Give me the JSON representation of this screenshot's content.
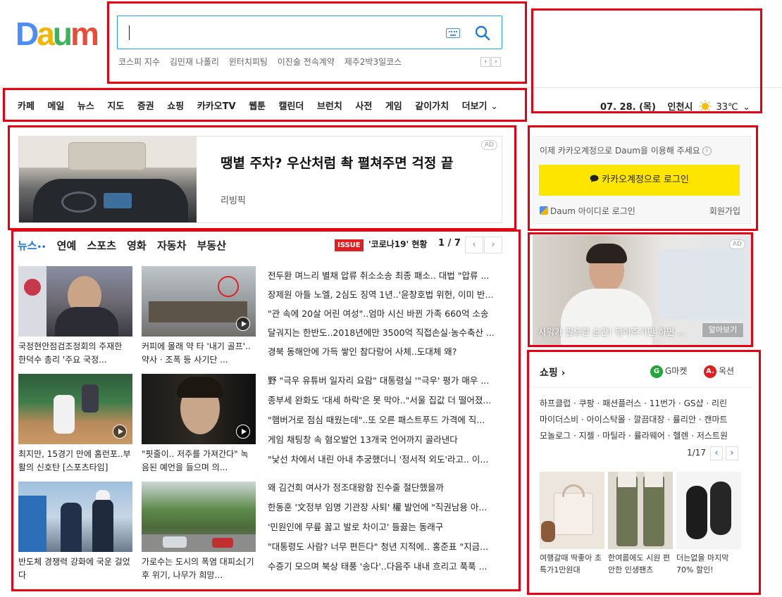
{
  "logo": {
    "text": "Daum",
    "letters": [
      "D",
      "a",
      "u",
      "m"
    ],
    "colors": [
      "#4e8df5",
      "#f5b400",
      "#3cb25c",
      "#ea4c3a"
    ]
  },
  "search": {
    "placeholder": "",
    "trending": [
      "코스피 지수",
      "김민재 나폴리",
      "윈터치피팅",
      "이진술 전속계약",
      "제주2박3일코스"
    ],
    "prev": "‹",
    "next": "›"
  },
  "nav": {
    "items": [
      "카페",
      "메일",
      "뉴스",
      "지도",
      "증권",
      "쇼핑",
      "카카오TV",
      "웹툰",
      "캘린더",
      "브런치",
      "사전",
      "게임",
      "같이가치",
      "더보기"
    ]
  },
  "weather": {
    "date": "07. 28. (목)",
    "city": "인천시",
    "temp": "33℃"
  },
  "ad_banner": {
    "tag": "AD",
    "headline": "땡볕 주차? 우산처럼 촥 펼쳐주면 걱정 끝",
    "brand": "리빙픽"
  },
  "news": {
    "tabs": [
      "뉴스",
      "연예",
      "스포츠",
      "영화",
      "자동차",
      "부동산"
    ],
    "issue_badge": "ISSUE",
    "issue_text": "'코로나19' 현황",
    "page": "1 / 7",
    "cards": [
      {
        "caption": "국정현안점검조정회의 주재한 한덕수 총리 '주요 국정..."
      },
      {
        "caption": "커피에 몰래 약 타 '내기 골프'..약사 · 조폭 등 사기단 ..."
      },
      {
        "caption": "최지만, 15경기 만에 홈런포..부활의 신호탄 [스포츠타임]"
      },
      {
        "caption": "\"핏줄이.. 저주를 가져간다\" 녹음된 예언을 들으며 의..."
      },
      {
        "caption": "반도체 경쟁력 강화에 국운 걸었다"
      },
      {
        "caption": "가로수는 도시의 폭염 대피소[기후 위기, 나무가 희망..."
      }
    ],
    "headlines": [
      "전두환 며느리 별채 압류 취소소송 최종 패소.. 대법 \"압류 ...",
      "장제원 아들 노엘, 2심도 징역 1년..'윤창호법 위헌, 이미 반...",
      "\"관 속에 20살 어린 여성\"..엄마 시신 바뀐 가족 660억 소송",
      "달궈지는 한반도..2018년에만 3500억 직접손실·농수축산 ...",
      "경북 동해안에 가득 쌓인 참다랑어 사체..도대체 왜?",
      "野 \"극우 유튜버 일자리 요람\" 대통령실 '\"극우' 평가 매우 ...",
      "종부세 완화도 '대세 하락'은 못 막아..\"서울 집값 더 떨어졌...",
      "\"햄버거로 점심 때웠는데\"..또 오른 패스트푸드 가격에 직...",
      "게임 채팅창 속 혐오발언 13개국 언어까지 골라낸다",
      "\"낯선 차에서 내린 아내 추궁했더니 '정서적 외도'라고.. 이...",
      "왜 김건희 여사가 정조대왕함 진수줄 절단했을까",
      "한동훈 '文정부 임명 기관장 사퇴' 權 발언에 \"직권남용 아...",
      "'민원인에 무릎 꿇고 발로 차이고' 들끓는 동래구",
      "\"대통령도 사람? 너무 편든다\" 청년 지적에.. 홍준표 \"지금...",
      "수증기 모으며 북상 태풍 '송다'..다음주 내내 흐리고 푹푹 ..."
    ]
  },
  "login": {
    "message": "이제 카카오계정으로 Daum을 이용해 주세요",
    "info": "i",
    "kakao_button": "카카오계정으로 로그인",
    "daum_login": "Daum 아이디로 로그인",
    "signup": "회원가입"
  },
  "side_ad": {
    "tag": "AD",
    "text": "사워가 필요한 순간! 닦아주기만 하면 ...",
    "button": "알아보기"
  },
  "shopping": {
    "title": "쇼핑 ›",
    "gmarket_logo": "G",
    "gmarket": "G마켓",
    "auction_logo": "A.",
    "auction": "옥션",
    "list": [
      "하프클럽 · 쿠팡 · 패션플러스 · 11번가 · GS샵 · 리린",
      "마이더스비 · 아이스탁몰 · 깔끔대장 · 률리안 · 캔마트",
      "모놀로그 · 지젤 · 마틸라 · 률라웨어 · 헬렌 · 저스트원"
    ],
    "page": "1/17",
    "products": [
      {
        "caption": "여행갈때 딱좋아 초특가1만원대"
      },
      {
        "caption": "한여름에도 시원 편안한 인생팬츠"
      },
      {
        "caption": "더는없을 마지막 70% 할인!"
      }
    ]
  }
}
